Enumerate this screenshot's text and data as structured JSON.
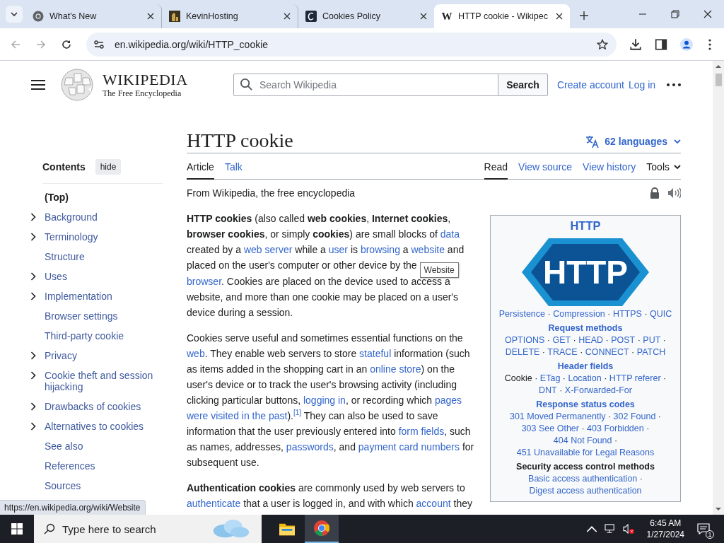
{
  "browser": {
    "tabs": [
      {
        "title": "What's New",
        "selected": false
      },
      {
        "title": "KevinHosting",
        "selected": false
      },
      {
        "title": "Cookies Policy",
        "selected": false
      },
      {
        "title": "HTTP cookie - Wikipec",
        "icon_text": "W",
        "selected": true
      }
    ],
    "url": "en.wikipedia.org/wiki/HTTP_cookie",
    "back_disabled": true,
    "forward_disabled": true
  },
  "header": {
    "wordmark": "WIKIPEDIA",
    "tagline": "The Free Encyclopedia",
    "search_placeholder": "Search Wikipedia",
    "search_button": "Search",
    "links": [
      "Create account",
      "Log in"
    ]
  },
  "contents": {
    "heading": "Contents",
    "hide_button": "hide",
    "items": [
      {
        "label": "(Top)",
        "expandable": false,
        "selected": true
      },
      {
        "label": "Background",
        "expandable": true,
        "selected": false
      },
      {
        "label": "Terminology",
        "expandable": true,
        "selected": false
      },
      {
        "label": "Structure",
        "expandable": false,
        "selected": false
      },
      {
        "label": "Uses",
        "expandable": true,
        "selected": false
      },
      {
        "label": "Implementation",
        "expandable": true,
        "selected": false
      },
      {
        "label": "Browser settings",
        "expandable": false,
        "selected": false
      },
      {
        "label": "Third-party cookie",
        "expandable": false,
        "selected": false
      },
      {
        "label": "Privacy",
        "expandable": true,
        "selected": false
      },
      {
        "label": "Cookie theft and session hijacking",
        "expandable": true,
        "selected": false
      },
      {
        "label": "Drawbacks of cookies",
        "expandable": true,
        "selected": false
      },
      {
        "label": "Alternatives to cookies",
        "expandable": true,
        "selected": false
      },
      {
        "label": "See also",
        "expandable": false,
        "selected": false
      },
      {
        "label": "References",
        "expandable": false,
        "selected": false
      },
      {
        "label": "Sources",
        "expandable": false,
        "selected": false
      }
    ]
  },
  "article": {
    "title": "HTTP cookie",
    "languages": "62 languages",
    "tabs_left": [
      {
        "label": "Article",
        "selected": true
      },
      {
        "label": "Talk",
        "selected": false
      }
    ],
    "tabs_right": [
      {
        "label": "Read",
        "selected": true
      },
      {
        "label": "View source",
        "selected": false
      },
      {
        "label": "View history",
        "selected": false
      }
    ],
    "tools": "Tools",
    "tagline": "From Wikipedia, the free encyclopedia",
    "paragraphs": [
      [
        {
          "kind": "bold",
          "text": "HTTP cookies"
        },
        {
          "kind": "text",
          "text": " (also called "
        },
        {
          "kind": "bold",
          "text": "web cookies"
        },
        {
          "kind": "text",
          "text": ", "
        },
        {
          "kind": "bold",
          "text": "Internet cookies"
        },
        {
          "kind": "text",
          "text": ", "
        },
        {
          "kind": "bold",
          "text": "browser cookies"
        },
        {
          "kind": "text",
          "text": ", or simply "
        },
        {
          "kind": "bold",
          "text": "cookies"
        },
        {
          "kind": "text",
          "text": ") are small blocks of "
        },
        {
          "kind": "link",
          "text": "data"
        },
        {
          "kind": "text",
          "text": " created by a "
        },
        {
          "kind": "link",
          "text": "web server"
        },
        {
          "kind": "text",
          "text": " while a "
        },
        {
          "kind": "link",
          "text": "user"
        },
        {
          "kind": "text",
          "text": " is "
        },
        {
          "kind": "link",
          "text": "browsing"
        },
        {
          "kind": "text",
          "text": " a "
        },
        {
          "kind": "link",
          "text": "website"
        },
        {
          "kind": "text",
          "text": " and placed on the user's computer or other device by the "
        },
        {
          "kind": "tooltip",
          "text": "Website"
        },
        {
          "kind": "link",
          "text": "browser"
        },
        {
          "kind": "text",
          "text": ". Cookies are placed on the device used to access a website, and more than one cookie may be placed on a user's device during a session."
        }
      ],
      [
        {
          "kind": "text",
          "text": "Cookies serve useful and sometimes essential functions on the "
        },
        {
          "kind": "link",
          "text": "web"
        },
        {
          "kind": "text",
          "text": ". They enable web servers to store "
        },
        {
          "kind": "link",
          "text": "stateful"
        },
        {
          "kind": "text",
          "text": " information (such as items added in the shopping cart in an "
        },
        {
          "kind": "link",
          "text": "online store"
        },
        {
          "kind": "text",
          "text": ") on the user's device or to track the user's browsing activity (including clicking particular buttons, "
        },
        {
          "kind": "link",
          "text": "logging in"
        },
        {
          "kind": "text",
          "text": ", or recording which "
        },
        {
          "kind": "link",
          "text": "pages",
          "space_after": true
        },
        {
          "kind": "link",
          "text": "were visited in the past"
        },
        {
          "kind": "text",
          "text": ")."
        },
        {
          "kind": "ref",
          "text": "[1]"
        },
        {
          "kind": "text",
          "text": " They can also be used to save information that the user previously entered into "
        },
        {
          "kind": "link",
          "text": "form fields"
        },
        {
          "kind": "text",
          "text": ", such as names, addresses, "
        },
        {
          "kind": "link",
          "text": "passwords"
        },
        {
          "kind": "text",
          "text": ", and "
        },
        {
          "kind": "link",
          "text": "payment card numbers"
        },
        {
          "kind": "text",
          "text": " for subsequent use."
        }
      ],
      [
        {
          "kind": "bold",
          "text": "Authentication cookies"
        },
        {
          "kind": "text",
          "text": " are commonly used by web servers to "
        },
        {
          "kind": "link",
          "text": "authenticate"
        },
        {
          "kind": "text",
          "text": " that a user is logged in, and with which "
        },
        {
          "kind": "link",
          "text": "account"
        },
        {
          "kind": "text",
          "text": " they"
        }
      ]
    ]
  },
  "infobox": {
    "title": "HTTP",
    "logo_text": "HTTP",
    "separator": "·",
    "sections": [
      {
        "items": [
          {
            "text": "Persistence",
            "current": false
          },
          {
            "text": "Compression",
            "current": false
          },
          {
            "text": "HTTPS",
            "current": false
          },
          {
            "text": "QUIC",
            "current": false
          }
        ]
      },
      {
        "heading": "Request methods",
        "heading_link": true,
        "items": [
          {
            "text": "OPTIONS",
            "current": false
          },
          {
            "text": "GET",
            "current": false
          },
          {
            "text": "HEAD",
            "current": false
          },
          {
            "text": "POST",
            "current": false
          },
          {
            "text": "PUT",
            "current": false
          },
          {
            "text": "DELETE",
            "current": false
          },
          {
            "text": "TRACE",
            "current": false
          },
          {
            "text": "CONNECT",
            "current": false
          },
          {
            "text": "PATCH",
            "current": false
          }
        ]
      },
      {
        "heading": "Header fields",
        "heading_link": true,
        "items": [
          {
            "text": "Cookie",
            "current": true
          },
          {
            "text": "ETag",
            "current": false
          },
          {
            "text": "Location",
            "current": false
          },
          {
            "text": "HTTP referer",
            "current": false
          },
          {
            "text": "DNT",
            "current": false
          },
          {
            "text": "X-Forwarded-For",
            "current": false
          }
        ]
      },
      {
        "heading": "Response status codes",
        "heading_link": true,
        "items": [
          {
            "text": "301 Moved Permanently",
            "current": false
          },
          {
            "text": "302 Found",
            "current": false
          },
          {
            "text": "303 See Other",
            "current": false
          },
          {
            "text": "403 Forbidden",
            "current": false
          },
          {
            "text": "404 Not Found",
            "current": false
          },
          {
            "text": "451 Unavailable for Legal Reasons",
            "current": false
          }
        ]
      },
      {
        "heading": "Security access control methods",
        "heading_link": false,
        "items": [
          {
            "text": "Basic access authentication",
            "current": false
          },
          {
            "text": "Digest access authentication",
            "current": false
          }
        ]
      }
    ]
  },
  "status_url": "https://en.wikipedia.org/wiki/Website",
  "taskbar": {
    "search_placeholder": "Type here to search",
    "time": "6:45 AM",
    "date": "1/27/2024",
    "notifications": "1",
    "sound_muted": true
  }
}
